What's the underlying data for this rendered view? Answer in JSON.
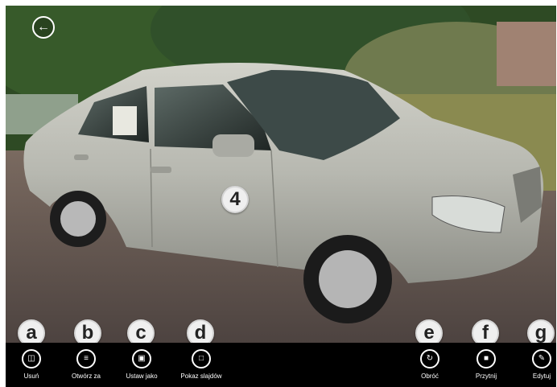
{
  "viewer": {
    "back_icon": "back-arrow-icon",
    "photo_subject": "silver sedan car parked on cobblestone"
  },
  "callouts": [
    "a",
    "b",
    "c",
    "d",
    "e",
    "f",
    "g",
    "4"
  ],
  "app_bar": {
    "commands": [
      {
        "key": "delete",
        "label": "Usuń",
        "icon": "trash-icon"
      },
      {
        "key": "open_with",
        "label": "Otwórz za",
        "icon": "open-with-icon"
      },
      {
        "key": "set_as",
        "label": "Ustaw jako",
        "icon": "set-as-icon"
      },
      {
        "key": "slideshow",
        "label": "Pokaz slajdów",
        "icon": "slideshow-icon"
      },
      {
        "key": "rotate",
        "label": "Obróć",
        "icon": "rotate-icon"
      },
      {
        "key": "crop",
        "label": "Przytnij",
        "icon": "crop-icon"
      },
      {
        "key": "edit",
        "label": "Edytuj",
        "icon": "edit-icon"
      }
    ]
  },
  "colors": {
    "app_bar_bg": "#000000",
    "app_bar_fg": "#ffffff",
    "callout_bg": "#efefef",
    "car_silver": "#b9b9b1"
  }
}
